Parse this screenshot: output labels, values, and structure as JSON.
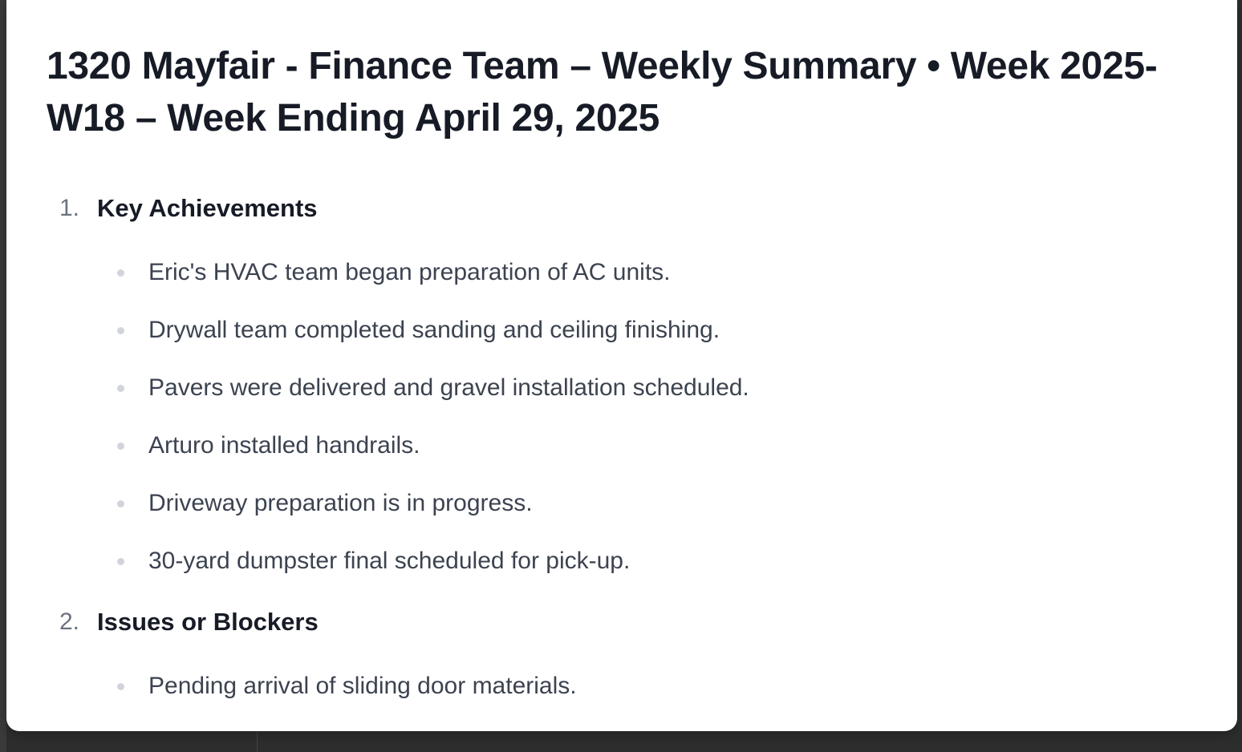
{
  "document": {
    "title": "1320 Mayfair - Finance Team – Weekly Summary • Week 2025-W18 – Week Ending April 29, 2025",
    "sections": [
      {
        "number": "1.",
        "heading": "Key Achievements",
        "items": [
          "Eric's HVAC team began preparation of AC units.",
          "Drywall team completed sanding and ceiling finishing.",
          "Pavers were delivered and gravel installation scheduled.",
          "Arturo installed handrails.",
          "Driveway preparation is in progress.",
          "30-yard dumpster final scheduled for pick-up."
        ]
      },
      {
        "number": "2.",
        "heading": "Issues or Blockers",
        "items": [
          "Pending arrival of sliding door materials."
        ]
      }
    ]
  },
  "colors": {
    "title": "#161b26",
    "body_text": "#3c4350",
    "list_number": "#6b7280",
    "bullet": "#d1d5db",
    "panel": "#ffffff",
    "backdrop": "#2d2d2d"
  }
}
